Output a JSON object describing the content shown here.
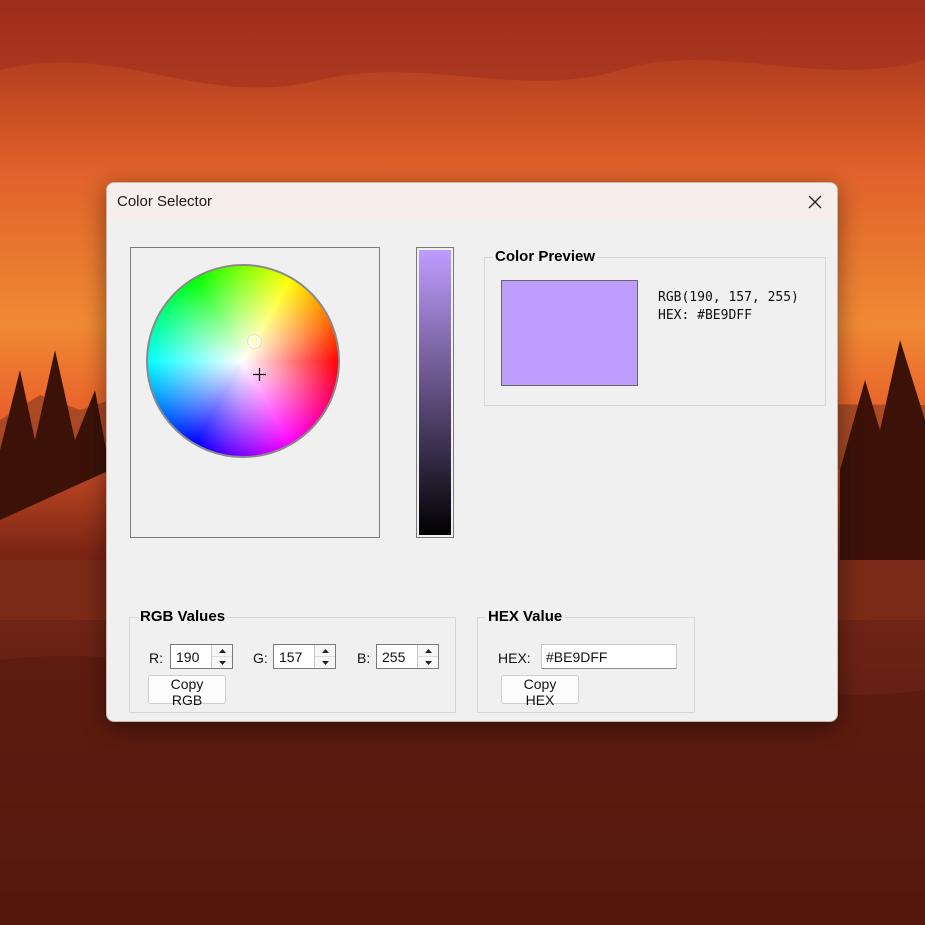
{
  "window": {
    "title": "Color Selector"
  },
  "colors": {
    "selected": "#be9dff"
  },
  "preview": {
    "group_title": "Color Preview",
    "rgb_text": "RGB(190, 157, 255)",
    "hex_text": "HEX: #BE9DFF"
  },
  "rgb": {
    "group_title": "RGB Values",
    "r_label": "R:",
    "r_value": "190",
    "g_label": "G:",
    "g_value": "157",
    "b_label": "B:",
    "b_value": "255",
    "copy_label": "Copy RGB"
  },
  "hex": {
    "group_title": "HEX Value",
    "label": "HEX:",
    "value": "#BE9DFF",
    "copy_label": "Copy HEX"
  },
  "icons": {
    "close": "close-icon",
    "crosshair": "crosshair-icon",
    "spin_up": "chevron-up-icon",
    "spin_down": "chevron-down-icon"
  }
}
